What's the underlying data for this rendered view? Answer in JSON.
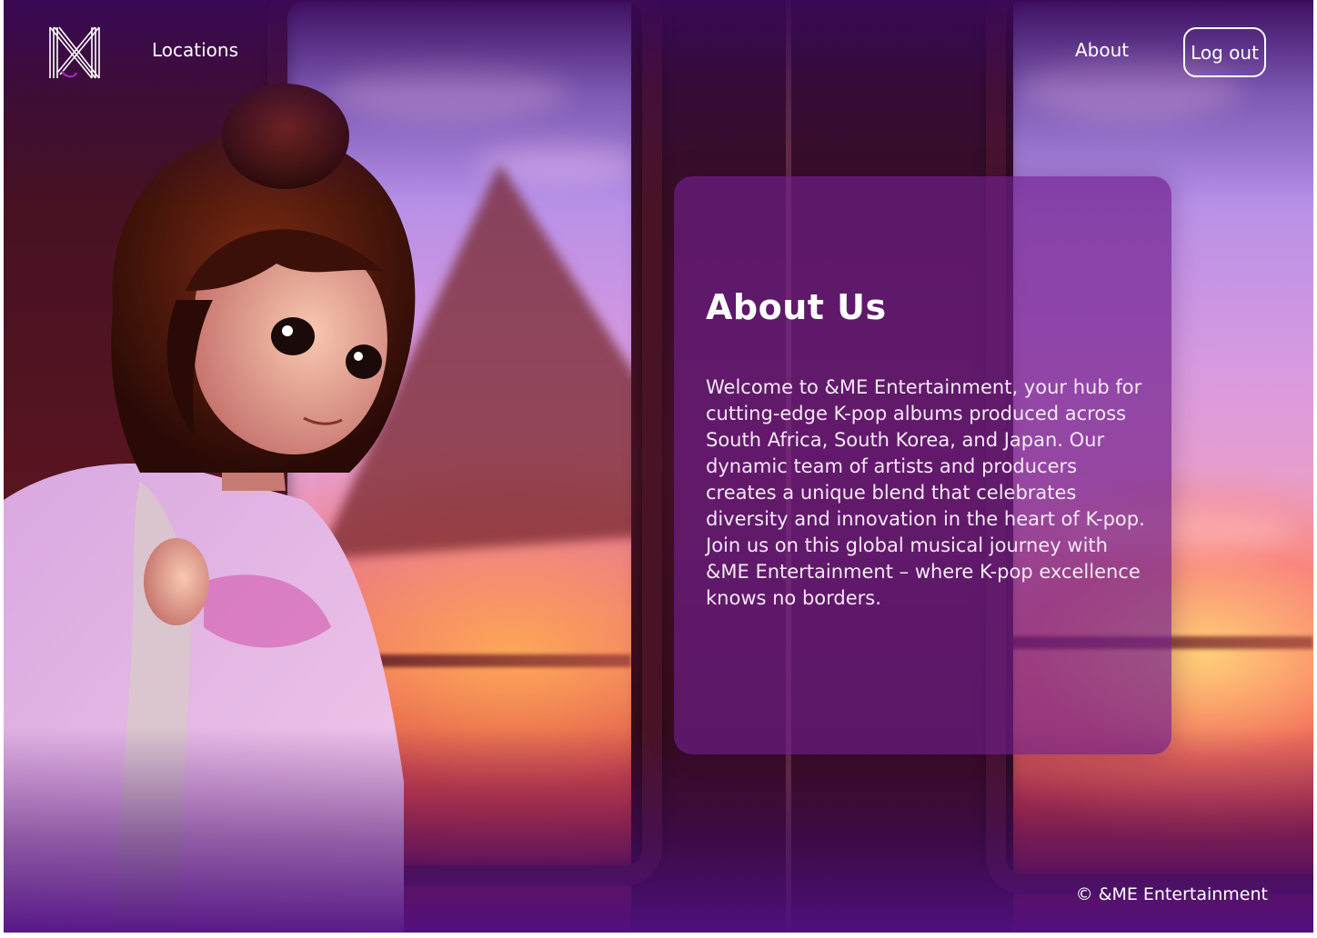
{
  "nav": {
    "logo_icon": "and-me-monogram-logo",
    "locations_label": "Locations",
    "about_label": "About",
    "logout_label": "Log out"
  },
  "about": {
    "title": "About Us",
    "body": "Welcome to &ME Entertainment, your hub for cutting-edge K-pop albums produced across South Africa, South Korea, and Japan. Our dynamic team of artists and producers creates a unique blend that celebrates diversity and innovation in the heart of K-pop. Join us on this global musical journey with &ME Entertainment – where K-pop excellence knows no borders."
  },
  "footer": {
    "copyright": "© &ME Entertainment"
  },
  "colors": {
    "card_background": "#6e1e8c",
    "header_fade": "#3a085a",
    "footer_fade": "#501082",
    "text": "#ffffff"
  }
}
